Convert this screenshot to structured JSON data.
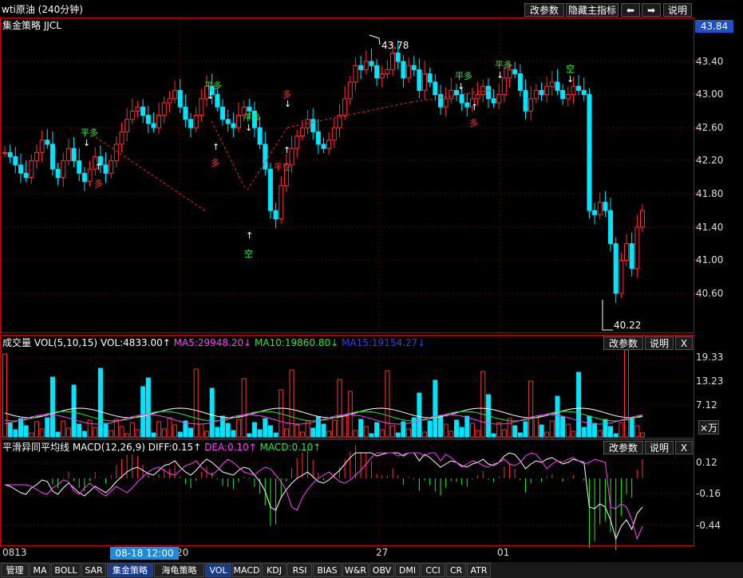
{
  "toolbar": {
    "title": "wti原油 (240分钟)",
    "btn_change_params": "改参数",
    "btn_hide_main": "隐藏主指标",
    "btn_left": "⬅",
    "btn_right": "➡",
    "btn_help": "说明"
  },
  "main_panel": {
    "strategy_label": "集金策略 JJCL",
    "current_price": "43.84",
    "high_label": "43.78",
    "low_label": "40.22",
    "y_ticks": [
      "43.40",
      "43.00",
      "42.60",
      "42.20",
      "41.80",
      "41.40",
      "41.00",
      "40.60"
    ],
    "signals": {
      "ping_duo_1": "平多",
      "duo_1": "多",
      "ping_duo_2": "平多",
      "duo_2": "多",
      "ping_duo_3": "平多",
      "kong_1": "空",
      "duo_3": "多",
      "ping_kong_1": "平空",
      "ping_duo_4": "平多",
      "duo_4": "多",
      "ping_duo_5": "平多",
      "kong_2": "空"
    }
  },
  "volume_panel": {
    "title": "成交量 VOL(5,10,15)",
    "vol": "VOL:4833.00↑",
    "ma5": "MA5:29948.20↓",
    "ma10": "MA10:19860.80↓",
    "ma15": "MA15:19154.27↓",
    "btn_change_params": "改参数",
    "btn_help": "说明",
    "btn_close": "X",
    "y_ticks": [
      "19.33",
      "13.23",
      "7.12"
    ],
    "unit_button": "×万"
  },
  "macd_panel": {
    "title": "平滑异同平均线 MACD(12,26,9)",
    "diff": "DIFF:0.15↑",
    "dea": "DEA:0.10↑",
    "macd": "MACD:0.10↑",
    "btn_change_params": "改参数",
    "btn_help": "说明",
    "btn_close": "X",
    "y_ticks": [
      "0.12",
      "-0.16",
      "-0.44"
    ]
  },
  "x_axis": {
    "labels": [
      "0813",
      "20",
      "27",
      "01"
    ],
    "cursor_label": "08-18 12:00"
  },
  "bottom_tabs": [
    "管理",
    "MA",
    "BOLL",
    "SAR",
    "集金策略",
    "海龟策略",
    "VOL",
    "MACD",
    "KDJ",
    "RSI",
    "BIAS",
    "W&R",
    "OBV",
    "DMI",
    "CCI",
    "CR",
    "ATR"
  ],
  "colors": {
    "up": "#ff3030",
    "down": "#00e5ff",
    "grid": "#7a0000",
    "ma5": "#ffffff",
    "ma10": "#e0e000",
    "ma15": "#ff40ff",
    "diff": "#ffffff",
    "dea": "#ff40ff",
    "signal_green": "#2ee82e",
    "signal_red": "#ff3030"
  }
}
